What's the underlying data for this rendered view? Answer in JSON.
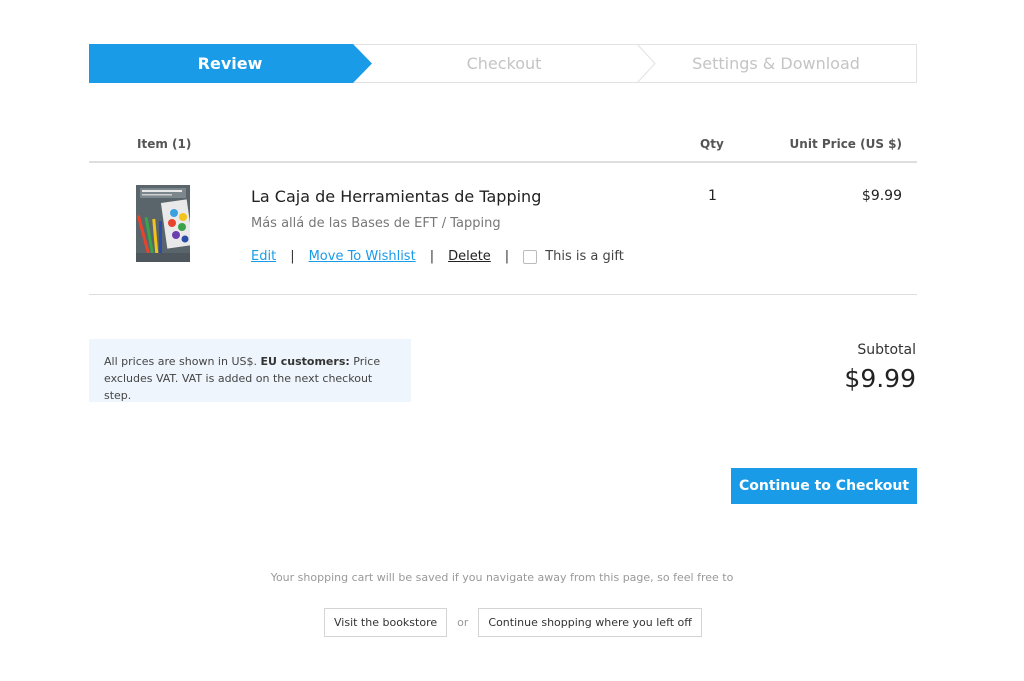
{
  "stepper": {
    "steps": [
      {
        "label": "Review",
        "active": true
      },
      {
        "label": "Checkout",
        "active": false
      },
      {
        "label": "Settings & Download",
        "active": false
      }
    ],
    "active_color": "#1a9be8"
  },
  "table": {
    "headers": {
      "item": "Item (1)",
      "qty": "Qty",
      "price": "Unit Price (US $)"
    }
  },
  "item": {
    "title": "La Caja de Herramientas de Tapping",
    "subtitle": "Más allá de las Bases de EFT / Tapping",
    "qty": "1",
    "price": "$9.99",
    "actions": {
      "edit": "Edit",
      "wishlist": "Move To Wishlist",
      "delete": "Delete",
      "gift": "This is a gift"
    }
  },
  "info": {
    "prefix": "All prices are shown in US$. ",
    "bold": "EU customers:",
    "suffix": " Price excludes VAT. VAT is added on the next checkout step."
  },
  "summary": {
    "subtotal_label": "Subtotal",
    "subtotal_value": "$9.99"
  },
  "checkout_button": "Continue to Checkout",
  "footer": {
    "note": "Your shopping cart will be saved if you navigate away from this page, so feel free to",
    "visit_button": "Visit the bookstore",
    "or": "or",
    "continue_button": "Continue shopping where you left off"
  },
  "colors": {
    "accent": "#1a9be8",
    "info_bg": "#eef5fc"
  }
}
